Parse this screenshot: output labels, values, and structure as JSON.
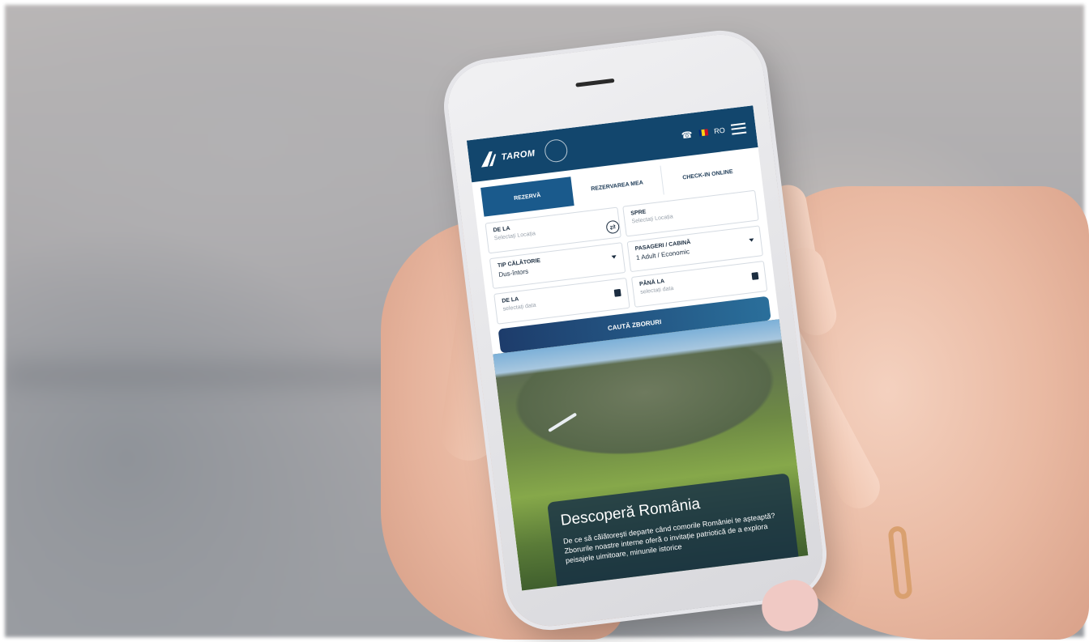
{
  "header": {
    "logo_text": "TAROM",
    "language": "RO",
    "flag_colors": [
      "#002b7f",
      "#fcd116",
      "#ce1126"
    ]
  },
  "tabs": [
    {
      "label": "REZERVĂ",
      "active": true
    },
    {
      "label": "REZERVAREA MEA",
      "active": false
    },
    {
      "label": "CHECK-IN ONLINE",
      "active": false
    }
  ],
  "form": {
    "from": {
      "label": "DE LA",
      "placeholder": "Selectați Locația"
    },
    "to": {
      "label": "SPRE",
      "placeholder": "Selectați Locația"
    },
    "trip_type": {
      "label": "TIP CĂLĂTORIE",
      "value": "Dus-întors"
    },
    "passengers": {
      "label": "PASAGERI / CABINĂ",
      "value": "1 Adult / Economic"
    },
    "depart_date": {
      "label": "DE LA",
      "placeholder": "selectați data"
    },
    "return_date": {
      "label": "PÂNĂ LA",
      "placeholder": "selectați data"
    },
    "search_label": "CAUTĂ ZBORURI"
  },
  "hero": {
    "title": "Descoperă România",
    "text": "De ce să călătorești departe când comorile României te așteaptă? Zborurile noastre interne oferă o invitație patriotică de a explora peisajele uimitoare, minunile istorice"
  },
  "colors": {
    "brand_blue": "#12466d",
    "tab_active": "#1a5a8c"
  }
}
